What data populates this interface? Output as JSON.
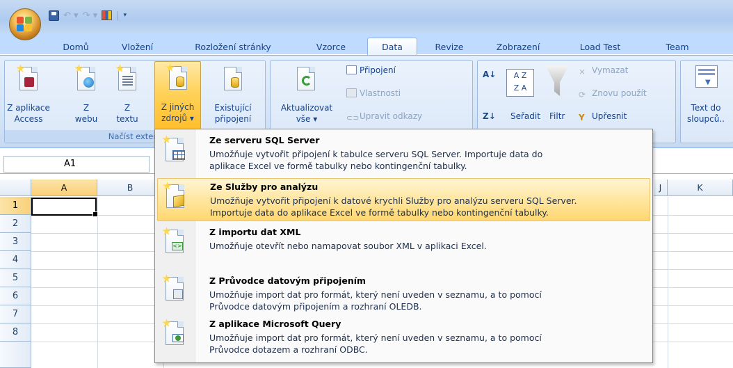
{
  "titlebar": {
    "qat_items": [
      "save-icon",
      "undo-icon",
      "redo-icon",
      "chart-icon",
      "customize-icon"
    ]
  },
  "tabs": [
    {
      "label": "Domů",
      "active": false
    },
    {
      "label": "Vložení",
      "active": false
    },
    {
      "label": "Rozložení stránky",
      "active": false
    },
    {
      "label": "Vzorce",
      "active": false
    },
    {
      "label": "Data",
      "active": true
    },
    {
      "label": "Revize",
      "active": false
    },
    {
      "label": "Zobrazení",
      "active": false
    },
    {
      "label": "Load Test",
      "active": false
    },
    {
      "label": "Team",
      "active": false
    }
  ],
  "ribbon": {
    "get_external": {
      "group_label": "Načíst extern",
      "access": "Z aplikace Access",
      "access_l1": "Z aplikace",
      "access_l2": "Access",
      "web_l1": "Z",
      "web_l2": "webu",
      "text_l1": "Z",
      "text_l2": "textu",
      "other_l1": "Z jiných",
      "other_l2": "zdrojů ▾",
      "existing_l1": "Existující",
      "existing_l2": "připojení"
    },
    "connections": {
      "refresh_l1": "Aktualizovat",
      "refresh_l2": "vše ▾",
      "connections": "Připojení",
      "properties": "Vlastnosti",
      "edit_links": "Upravit odkazy"
    },
    "sort_filter": {
      "sort": "Seřadit",
      "filter": "Filtr",
      "clear": "Vymazat",
      "reapply": "Znovu použít",
      "advanced": "Upřesnit"
    },
    "data_tools": {
      "text_to_columns_l1": "Text do",
      "text_to_columns_l2": "sloupců.."
    }
  },
  "namebox": {
    "value": "A1"
  },
  "grid": {
    "columns": [
      "A",
      "B",
      "K"
    ],
    "rows": [
      "1",
      "2",
      "3",
      "4",
      "5",
      "6",
      "7",
      "8"
    ],
    "partial_col": "J",
    "active_cell": "A1"
  },
  "menu": {
    "items": [
      {
        "title": "Ze serveru SQL Server",
        "desc_l1": "Umožňuje vytvořit připojení k tabulce serveru SQL Server. Importuje data do",
        "desc_l2": "aplikace Excel ve formě tabulky nebo kontingenční tabulky.",
        "highlighted": false,
        "icon": "sql-server-icon"
      },
      {
        "title": "Ze Služby pro analýzu",
        "desc_l1": "Umožňuje vytvořit připojení k datové krychli Služby pro analýzu serveru SQL Server.",
        "desc_l2": "Importuje data do aplikace Excel ve formě tabulky nebo kontingenční tabulky.",
        "highlighted": true,
        "icon": "analysis-services-icon"
      },
      {
        "title": "Z importu dat XML",
        "desc_l1": "Umožňuje otevřít nebo namapovat soubor XML v aplikaci Excel.",
        "desc_l2": "",
        "highlighted": false,
        "icon": "xml-icon"
      },
      {
        "title": "Z Průvodce datovým připojením",
        "desc_l1": "Umožňuje import dat pro formát, který není uveden v seznamu, a to pomocí",
        "desc_l2": "Průvodce datovým připojením a rozhraní OLEDB.",
        "highlighted": false,
        "icon": "data-connection-wizard-icon"
      },
      {
        "title": "Z aplikace Microsoft Query",
        "desc_l1": "Umožňuje import dat pro formát, který není uveden v seznamu, a to pomocí",
        "desc_l2": "Průvodce dotazem a rozhraní ODBC.",
        "highlighted": false,
        "icon": "microsoft-query-icon"
      }
    ]
  },
  "colors": {
    "accent": "#15428b",
    "highlight": "#ffd771",
    "ribbon": "#dbe8f8"
  }
}
